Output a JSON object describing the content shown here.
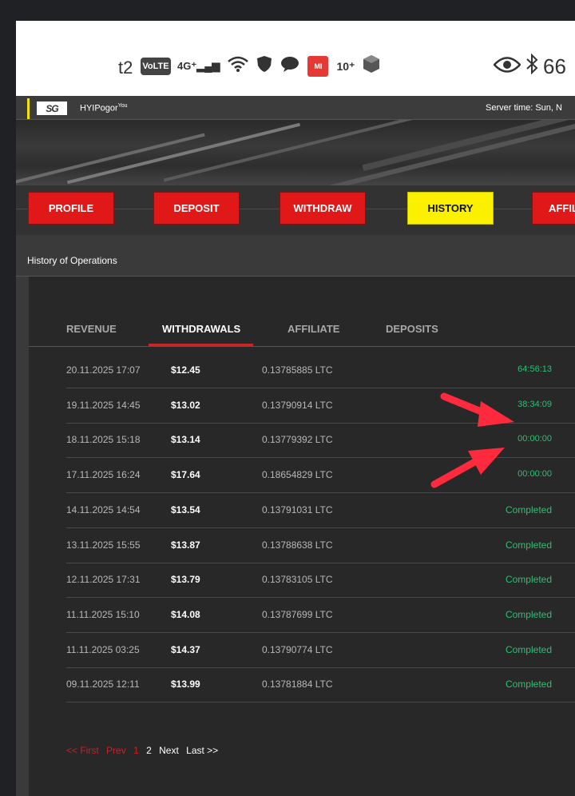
{
  "status_bar": {
    "carrier": "t2",
    "volte": "VoLTE",
    "network": "4G⁺",
    "badge": "MI",
    "extra": "10⁺",
    "right_text": "66"
  },
  "site": {
    "name": "HYIPogor",
    "name_sup": "You",
    "logo_text": "SG",
    "server_time": "Server time: Sun, N"
  },
  "nav": [
    {
      "label": "PROFILE",
      "active": false
    },
    {
      "label": "DEPOSIT",
      "active": false
    },
    {
      "label": "WITHDRAW",
      "active": false
    },
    {
      "label": "HISTORY",
      "active": true
    },
    {
      "label": "AFFIL",
      "active": false
    }
  ],
  "page_title": "History of Operations",
  "tabs": [
    {
      "label": "REVENUE",
      "active": false
    },
    {
      "label": "WITHDRAWALS",
      "active": true
    },
    {
      "label": "AFFILIATE",
      "active": false
    },
    {
      "label": "DEPOSITS",
      "active": false
    }
  ],
  "rows": [
    {
      "date": "20.11.2025 17:07",
      "amount": "$12.45",
      "ltc": "0.13785885 LTC",
      "status": "64:56:13"
    },
    {
      "date": "19.11.2025 14:45",
      "amount": "$13.02",
      "ltc": "0.13790914 LTC",
      "status": "38:34:09"
    },
    {
      "date": "18.11.2025 15:18",
      "amount": "$13.14",
      "ltc": "0.13779392 LTC",
      "status": "00:00:00"
    },
    {
      "date": "17.11.2025 16:24",
      "amount": "$17.64",
      "ltc": "0.18654829 LTC",
      "status": "00:00:00"
    },
    {
      "date": "14.11.2025 14:54",
      "amount": "$13.54",
      "ltc": "0.13791031 LTC",
      "status": "Completed"
    },
    {
      "date": "13.11.2025 15:55",
      "amount": "$13.87",
      "ltc": "0.13788638 LTC",
      "status": "Completed"
    },
    {
      "date": "12.11.2025 17:31",
      "amount": "$13.79",
      "ltc": "0.13783105 LTC",
      "status": "Completed"
    },
    {
      "date": "11.11.2025 15:10",
      "amount": "$14.08",
      "ltc": "0.13787699 LTC",
      "status": "Completed"
    },
    {
      "date": "11.11.2025 03:25",
      "amount": "$14.37",
      "ltc": "0.13790774 LTC",
      "status": "Completed"
    },
    {
      "date": "09.11.2025 12:11",
      "amount": "$13.99",
      "ltc": "0.13781884 LTC",
      "status": "Completed"
    }
  ],
  "pager": {
    "first": "<< First",
    "prev": "Prev",
    "current": "1",
    "page2": "2",
    "next": "Next",
    "last": "Last >>"
  },
  "colors": {
    "nav_red": "#e01818",
    "nav_active": "#fbf000",
    "status_green": "#2fbf71",
    "annotation_arrow": "#ff2a3d"
  }
}
